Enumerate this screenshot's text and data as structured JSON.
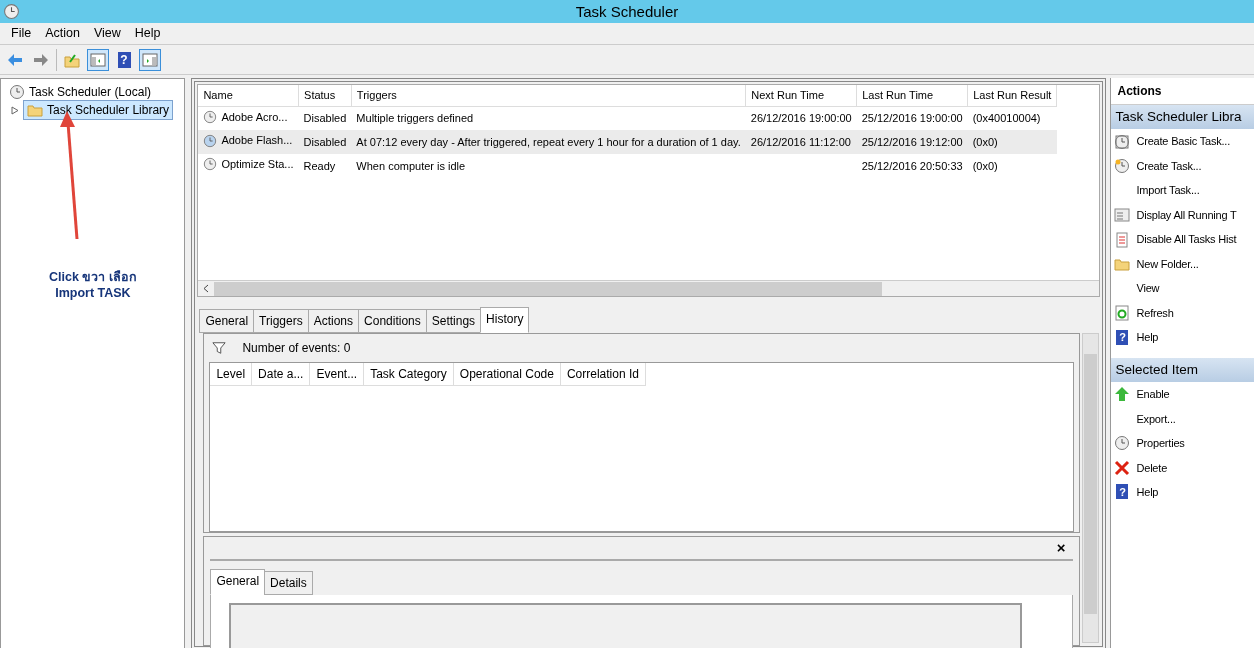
{
  "window": {
    "title": "Task Scheduler"
  },
  "menu": [
    {
      "label": "File"
    },
    {
      "label": "Action"
    },
    {
      "label": "View"
    },
    {
      "label": "Help"
    }
  ],
  "toolbar": [
    {
      "kind": "back",
      "on": false
    },
    {
      "kind": "forward",
      "on": false
    },
    {
      "kind": "separator"
    },
    {
      "kind": "up",
      "on": false
    },
    {
      "kind": "console-tree",
      "on": true
    },
    {
      "kind": "help",
      "on": false,
      "glyph": "?"
    },
    {
      "kind": "action-pane",
      "on": true
    }
  ],
  "tree": [
    {
      "label": "Task Scheduler (Local)",
      "selected": false,
      "kind": "clock",
      "children": [
        {
          "label": "Task Scheduler Library",
          "selected": true,
          "expanded": false,
          "kind": "folder"
        }
      ]
    }
  ],
  "annotation": {
    "lines": [
      "Click ขวา เลือก",
      "Import TASK"
    ]
  },
  "tasks": {
    "columns": [
      "Name",
      "Status",
      "Triggers",
      "Next Run Time",
      "Last Run Time",
      "Last Run Result"
    ],
    "rows": [
      {
        "selected": false,
        "cells": [
          "Adobe Acro...",
          "Disabled",
          "Multiple triggers defined",
          "26/12/2016 19:00:00",
          "25/12/2016 19:00:00",
          "(0x40010004)"
        ]
      },
      {
        "selected": true,
        "cells": [
          "Adobe Flash...",
          "Disabled",
          "At 07:12 every day - After triggered, repeat every 1 hour for a duration of 1 day.",
          "26/12/2016 11:12:00",
          "25/12/2016 19:12:00",
          "(0x0)"
        ]
      },
      {
        "selected": false,
        "cells": [
          "Optimize Sta...",
          "Ready",
          "When computer is idle",
          "",
          "25/12/2016 20:50:33",
          "(0x0)"
        ]
      }
    ]
  },
  "detail_tabs": [
    {
      "label": "General",
      "selected": false
    },
    {
      "label": "Triggers",
      "selected": false
    },
    {
      "label": "Actions",
      "selected": false
    },
    {
      "label": "Conditions",
      "selected": false
    },
    {
      "label": "Settings",
      "selected": false
    },
    {
      "label": "History",
      "selected": true
    }
  ],
  "history": {
    "count": "Number of events: 0",
    "columns": [
      "Level",
      "Date a...",
      "Event...",
      "Task Category",
      "Operational Code",
      "Correlation Id"
    ]
  },
  "event_panel": {
    "close": "×",
    "tabs": [
      {
        "label": "General",
        "selected": true
      },
      {
        "label": "Details",
        "selected": false
      }
    ]
  },
  "actions": {
    "title": "Actions",
    "sections": [
      {
        "title": "Task Scheduler Libra",
        "items": [
          {
            "label": "Create Basic Task...",
            "kind": "wizard"
          },
          {
            "label": "Create Task...",
            "kind": "clock-star"
          },
          {
            "label": "Import Task...",
            "kind": "none"
          },
          {
            "label": "Display All Running T",
            "kind": "list"
          },
          {
            "label": "Disable All Tasks Hist",
            "kind": "log"
          },
          {
            "label": "New Folder...",
            "kind": "folder"
          },
          {
            "label": "View",
            "kind": "none"
          },
          {
            "label": "Refresh",
            "kind": "refresh"
          },
          {
            "label": "Help",
            "kind": "help",
            "glyph": "?"
          }
        ]
      },
      {
        "title": "Selected Item",
        "items": [
          {
            "label": "Enable",
            "kind": "up-arrow"
          },
          {
            "label": "Export...",
            "kind": "none"
          },
          {
            "label": "Properties",
            "kind": "clock"
          },
          {
            "label": "Delete",
            "kind": "delete"
          },
          {
            "label": "Help",
            "kind": "help",
            "glyph": "?"
          }
        ]
      }
    ]
  }
}
